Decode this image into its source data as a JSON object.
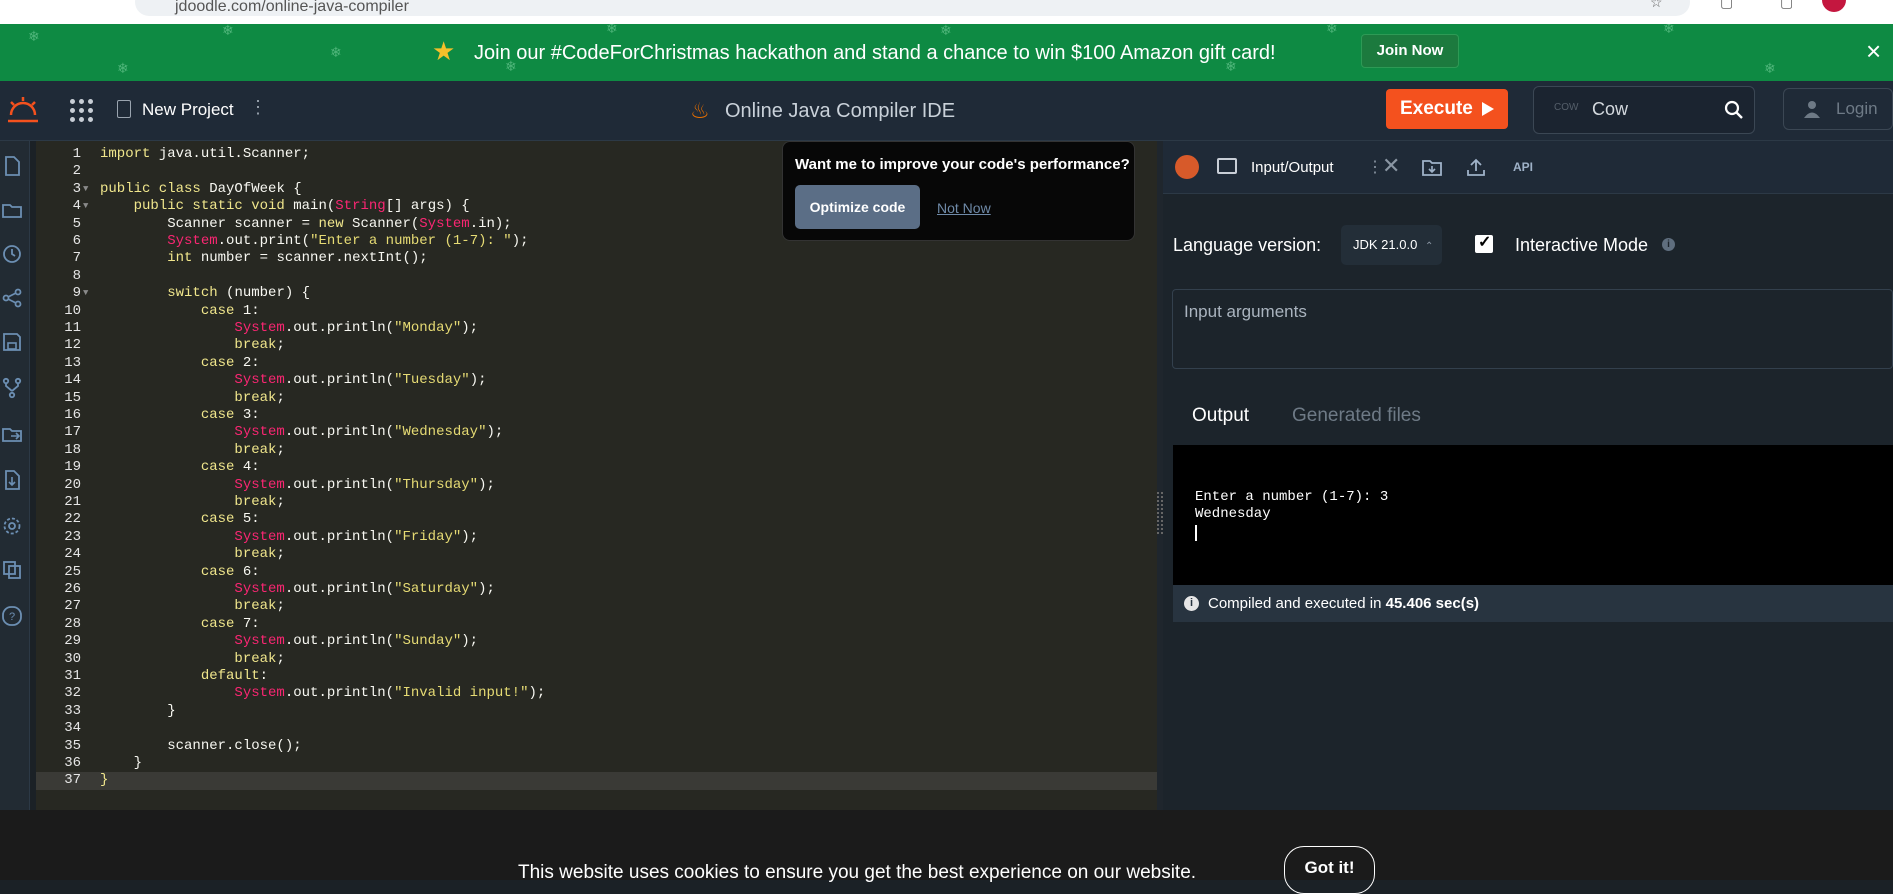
{
  "browser": {
    "url": "jdoodle.com/online-java-compiler"
  },
  "banner": {
    "text": "Join our #CodeForChristmas hackathon and stand a chance to win $100 Amazon gift card!",
    "join_label": "Join Now",
    "close_icon": "×"
  },
  "header": {
    "project_name": "New Project",
    "project_menu": "⋮",
    "title": "Online Java Compiler IDE",
    "execute_label": "Execute",
    "search_small": "COW",
    "search_value": "Cow",
    "login_label": "Login"
  },
  "editor": {
    "lines": [
      {
        "n": "1",
        "html": "<span class=\"kw\">import</span> java.util.Scanner;"
      },
      {
        "n": "2",
        "html": ""
      },
      {
        "n": "3",
        "html": "<span class=\"kw\">public class</span> DayOfWeek {",
        "fold": true
      },
      {
        "n": "4",
        "html": "    <span class=\"kw\">public static void</span> main(<span class=\"sys\">String</span>[] args) {",
        "fold": true
      },
      {
        "n": "5",
        "html": "        Scanner scanner = <span class=\"kw\">new</span> Scanner(<span class=\"sys\">System</span>.in);"
      },
      {
        "n": "6",
        "html": "        <span class=\"sys\">System</span>.out.print(<span class=\"str\">\"Enter a number (1-7): \"</span>);"
      },
      {
        "n": "7",
        "html": "        <span class=\"kw\">int</span> number = scanner.nextInt();"
      },
      {
        "n": "8",
        "html": ""
      },
      {
        "n": "9",
        "html": "        <span class=\"kw\">switch</span> (number) {",
        "fold": true
      },
      {
        "n": "10",
        "html": "            <span class=\"kw\">case</span> 1:"
      },
      {
        "n": "11",
        "html": "                <span class=\"sys\">System</span>.out.println(<span class=\"str\">\"Monday\"</span>);"
      },
      {
        "n": "12",
        "html": "                <span class=\"kw\">break</span>;"
      },
      {
        "n": "13",
        "html": "            <span class=\"kw\">case</span> 2:"
      },
      {
        "n": "14",
        "html": "                <span class=\"sys\">System</span>.out.println(<span class=\"str\">\"Tuesday\"</span>);"
      },
      {
        "n": "15",
        "html": "                <span class=\"kw\">break</span>;"
      },
      {
        "n": "16",
        "html": "            <span class=\"kw\">case</span> 3:"
      },
      {
        "n": "17",
        "html": "                <span class=\"sys\">System</span>.out.println(<span class=\"str\">\"Wednesday\"</span>);"
      },
      {
        "n": "18",
        "html": "                <span class=\"kw\">break</span>;"
      },
      {
        "n": "19",
        "html": "            <span class=\"kw\">case</span> 4:"
      },
      {
        "n": "20",
        "html": "                <span class=\"sys\">System</span>.out.println(<span class=\"str\">\"Thursday\"</span>);"
      },
      {
        "n": "21",
        "html": "                <span class=\"kw\">break</span>;"
      },
      {
        "n": "22",
        "html": "            <span class=\"kw\">case</span> 5:"
      },
      {
        "n": "23",
        "html": "                <span class=\"sys\">System</span>.out.println(<span class=\"str\">\"Friday\"</span>);"
      },
      {
        "n": "24",
        "html": "                <span class=\"kw\">break</span>;"
      },
      {
        "n": "25",
        "html": "            <span class=\"kw\">case</span> 6:"
      },
      {
        "n": "26",
        "html": "                <span class=\"sys\">System</span>.out.println(<span class=\"str\">\"Saturday\"</span>);"
      },
      {
        "n": "27",
        "html": "                <span class=\"kw\">break</span>;"
      },
      {
        "n": "28",
        "html": "            <span class=\"kw\">case</span> 7:"
      },
      {
        "n": "29",
        "html": "                <span class=\"sys\">System</span>.out.println(<span class=\"str\">\"Sunday\"</span>);"
      },
      {
        "n": "30",
        "html": "                <span class=\"kw\">break</span>;"
      },
      {
        "n": "31",
        "html": "            <span class=\"kw\">default</span>:"
      },
      {
        "n": "32",
        "html": "                <span class=\"sys\">System</span>.out.println(<span class=\"str\">\"Invalid input!\"</span>);"
      },
      {
        "n": "33",
        "html": "        }"
      },
      {
        "n": "34",
        "html": ""
      },
      {
        "n": "35",
        "html": "        scanner.close();"
      },
      {
        "n": "36",
        "html": "    }"
      },
      {
        "n": "37",
        "html": "<span class=\"kw\">}</span>",
        "active": true
      }
    ]
  },
  "popup": {
    "title": "Want me to improve your code's performance?",
    "optimize_label": "Optimize code",
    "not_now_label": "Not Now"
  },
  "panel": {
    "io_tab_label": "Input/Output",
    "io_dots": "⋮",
    "io_close": "✕",
    "api_label": "API",
    "language_label": "Language version:",
    "jdk_value": "JDK 21.0.0",
    "jdk_chevron": "⌃",
    "interactive_label": "Interactive Mode",
    "interactive_checked": true,
    "input_placeholder": "Input arguments",
    "output_tab": "Output",
    "generated_tab": "Generated files",
    "console_lines": [
      "Enter a number (1-7): 3",
      "Wednesday"
    ],
    "status_prefix": "Compiled and executed in",
    "status_time": "45.406 sec(s)"
  },
  "cookie": {
    "text": "This website uses cookies to ensure you get the best experience on our website.",
    "button": "Got it!"
  },
  "colors": {
    "accent": "#f4511e",
    "banner": "#0e8a43",
    "editor_bg": "#272822"
  }
}
